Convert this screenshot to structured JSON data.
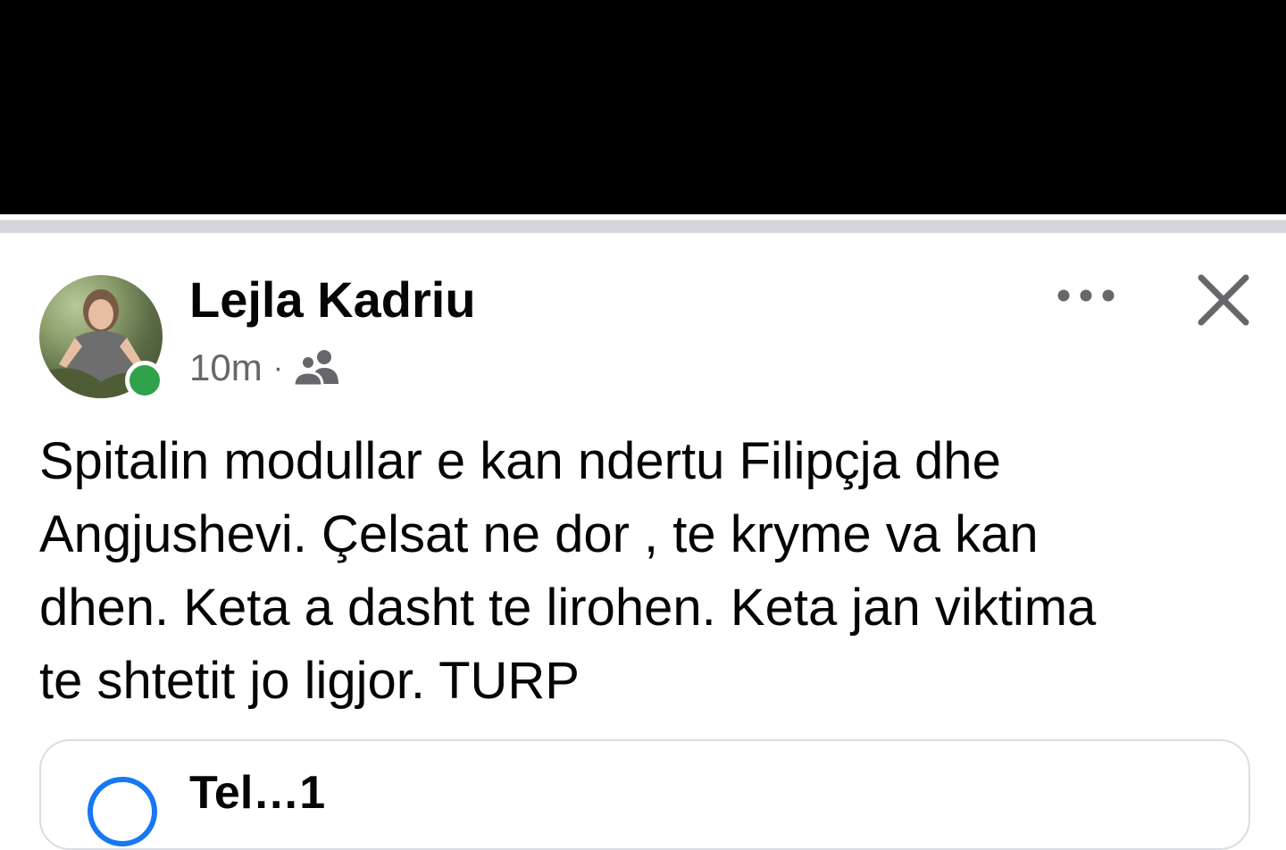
{
  "post": {
    "author_name": "Lejla Kadriu",
    "timestamp": "10m",
    "separator": "·",
    "audience_icon": "friends-icon",
    "more_icon": "more-options-icon",
    "close_icon": "close-icon",
    "online_status_color": "#31a24c",
    "text_lines": [
      "Spitalin modullar e kan ndertu Filipçja dhe",
      "Angjushevi. Çelsat ne dor , te kryme va kan",
      "dhen. Keta a dasht te lirohen. Keta jan viktima",
      "te shtetit jo ligjor. TURP"
    ]
  },
  "link_card": {
    "title": "Tel…1",
    "icon": "circle-icon",
    "accent_color": "#1877f2"
  }
}
